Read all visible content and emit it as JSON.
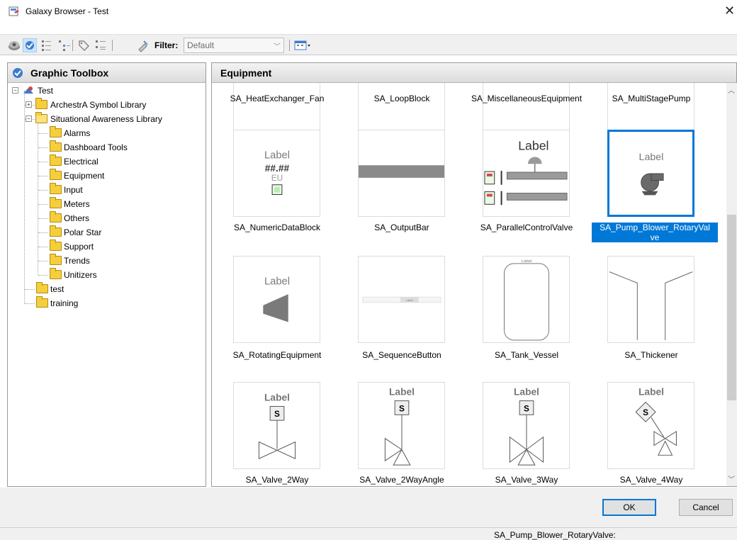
{
  "window": {
    "title": "Galaxy Browser - Test",
    "close_glyph": "✕"
  },
  "toolbar": {
    "icons": [
      "graphic-icon",
      "toolbox-icon",
      "list-view-icon",
      "tree-view-icon",
      "tag-icon",
      "details-icon",
      "filter-icon",
      "view-mode-icon"
    ],
    "filter_label": "Filter:",
    "filter_value": "Default"
  },
  "left_panel": {
    "title": "Graphic Toolbox",
    "tree": [
      {
        "label": "Test",
        "expander": "−"
      },
      {
        "label": "ArchestrA Symbol Library",
        "expander": "+"
      },
      {
        "label": "Situational Awareness Library",
        "expander": "−"
      },
      {
        "label": "Alarms"
      },
      {
        "label": "Dashboard Tools"
      },
      {
        "label": "Electrical"
      },
      {
        "label": "Equipment"
      },
      {
        "label": "Input"
      },
      {
        "label": "Meters"
      },
      {
        "label": "Others"
      },
      {
        "label": "Polar Star"
      },
      {
        "label": "Support"
      },
      {
        "label": "Trends"
      },
      {
        "label": "Unitizers"
      },
      {
        "label": "test"
      },
      {
        "label": "training"
      }
    ]
  },
  "right_panel": {
    "title": "Equipment",
    "items": [
      {
        "name": "SA_HeatExchanger_Fan"
      },
      {
        "name": "SA_LoopBlock"
      },
      {
        "name": "SA_MiscellaneousEquipment"
      },
      {
        "name": "SA_MultiStagePump"
      },
      {
        "name": "SA_NumericDataBlock",
        "preview_label": "Label",
        "preview_value": "##.##",
        "preview_unit": "EU"
      },
      {
        "name": "SA_OutputBar"
      },
      {
        "name": "SA_ParallelControlValve",
        "preview_label": "Label"
      },
      {
        "name": "SA_Pump_Blower_RotaryValve",
        "line2": "ve",
        "name_line1": "SA_Pump_Blower_RotaryVal",
        "preview_label": "Label",
        "selected": true
      },
      {
        "name": "SA_RotatingEquipment",
        "preview_label": "Label"
      },
      {
        "name": "SA_SequenceButton",
        "preview_label": "Label"
      },
      {
        "name": "SA_Tank_Vessel",
        "preview_label": "Label"
      },
      {
        "name": "SA_Thickener"
      },
      {
        "name": "SA_Valve_2Way",
        "preview_label": "Label",
        "preview_s": "S"
      },
      {
        "name": "SA_Valve_2WayAngle",
        "preview_label": "Label",
        "preview_s": "S"
      },
      {
        "name": "SA_Valve_3Way",
        "preview_label": "Label",
        "preview_s": "S"
      },
      {
        "name": "SA_Valve_4Way",
        "preview_label": "Label",
        "preview_s": "S"
      }
    ]
  },
  "buttons": {
    "ok": "OK",
    "cancel": "Cancel"
  },
  "status": {
    "text": "SA_Pump_Blower_RotaryValve:"
  },
  "colors": {
    "selection": "#0078d7",
    "folder": "#f5cf3b"
  }
}
